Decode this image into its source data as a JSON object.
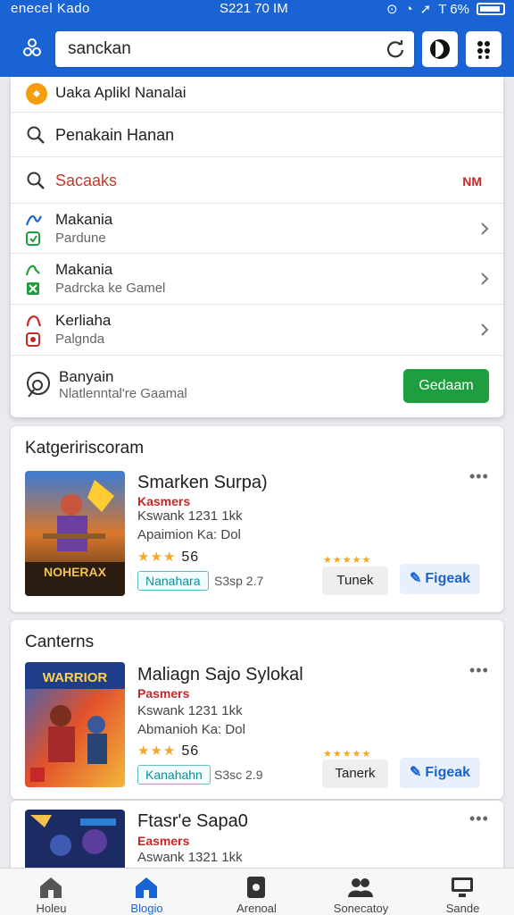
{
  "status_bar": {
    "carrier": "enecel Kado",
    "time": "S221 70 IM",
    "battery": "T 6%"
  },
  "header": {
    "search_value": "sanckan"
  },
  "dropdown": {
    "top_item": "Uaka Aplikl Nanalai",
    "search_suggestion": "Penakain Hanan",
    "search_highlight": "Sacaaks",
    "search_highlight_badge": "NM",
    "items": [
      {
        "title": "Makania",
        "subtitle": "Pardune"
      },
      {
        "title": "Makania",
        "subtitle": "Padrcka ke Gamel"
      },
      {
        "title": "Kerliaha",
        "subtitle": "Palgnda"
      }
    ],
    "last_item": {
      "title": "Banyain",
      "subtitle": "Nlatlenntal're Gaamal",
      "button": "Gedaam"
    }
  },
  "sections": [
    {
      "title": "Katgeririscoram",
      "game": {
        "title": "Smarken Surpa)",
        "developer": "Kasmers",
        "downloads": "Kswank 1231 1kk",
        "extra": "Apaimion Ka: Dol",
        "rating": "56",
        "tag": "Nanahara",
        "size": "S3sp 2.7",
        "btn_secondary": "Tunek",
        "btn_primary": "Figeak",
        "poster_text": "NOHERAX"
      }
    },
    {
      "title": "Canterns",
      "game": {
        "title": "Maliagn Sajo Sylokal",
        "developer": "Pasmers",
        "downloads": "Kswank 1231 1kk",
        "extra": "Abmanioh Ka: Dol",
        "rating": "56",
        "tag": "Kanahahn",
        "size": "S3sc 2.9",
        "btn_secondary": "Tanerk",
        "btn_primary": "Figeak",
        "poster_text": "WARRIOR"
      }
    },
    {
      "title": "",
      "game": {
        "title": "Ftasr'e Sapa0",
        "developer": "Easmers",
        "downloads": "Aswank 1321 1kk"
      }
    }
  ],
  "bottom_nav": [
    {
      "label": "Holeu",
      "icon": "home-icon",
      "active": false
    },
    {
      "label": "Blogio",
      "icon": "store-icon",
      "active": true
    },
    {
      "label": "Arenoal",
      "icon": "tablet-icon",
      "active": false
    },
    {
      "label": "Sonecatoy",
      "icon": "people-icon",
      "active": false
    },
    {
      "label": "Sande",
      "icon": "monitor-icon",
      "active": false
    }
  ],
  "colors": {
    "brand": "#1a63d4",
    "accent_green": "#1e9e3e",
    "star": "#f5a623",
    "danger": "#c62828"
  }
}
